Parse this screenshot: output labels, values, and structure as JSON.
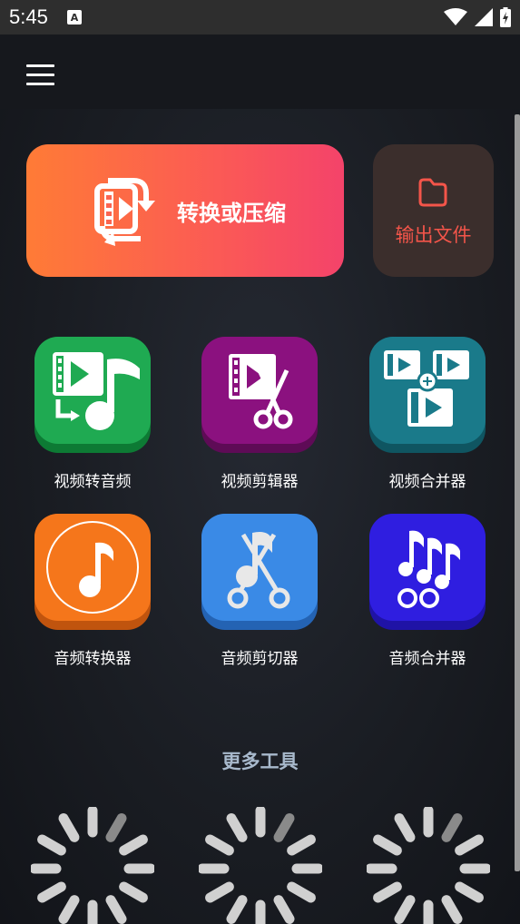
{
  "status_bar": {
    "time": "5:45",
    "notification_icon": "A"
  },
  "header": {
    "menu_icon": "hamburger-menu-icon"
  },
  "main_actions": {
    "convert_label": "转换或压缩",
    "output_label": "输出文件"
  },
  "tools": [
    {
      "label": "视频转音频",
      "icon": "video-to-audio-icon",
      "color": "#1faa52",
      "shadow": "#0d7a34"
    },
    {
      "label": "视频剪辑器",
      "icon": "video-editor-icon",
      "color": "#8b117f",
      "shadow": "#5e0b56"
    },
    {
      "label": "视频合并器",
      "icon": "video-merger-icon",
      "color": "#1a7a8a",
      "shadow": "#0f5561"
    },
    {
      "label": "音频转换器",
      "icon": "audio-converter-icon",
      "color": "#f5761b",
      "shadow": "#c0540e"
    },
    {
      "label": "音频剪切器",
      "icon": "audio-cutter-icon",
      "color": "#3a8ae6",
      "shadow": "#2463b3"
    },
    {
      "label": "音频合并器",
      "icon": "audio-merger-icon",
      "color": "#2f1ee0",
      "shadow": "#1f13a6"
    }
  ],
  "more_tools": {
    "title": "更多工具",
    "loading_indicators": 3
  }
}
